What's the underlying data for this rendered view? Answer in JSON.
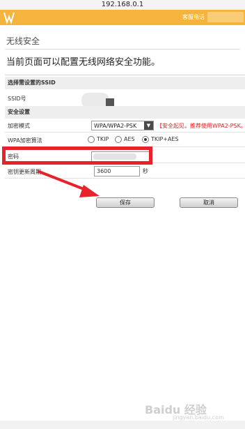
{
  "browser": {
    "address": "192.168.0.1"
  },
  "header": {
    "service_label": "客服电话"
  },
  "page": {
    "title": "无线安全",
    "description": "当前页面可以配置无线网络安全功能。"
  },
  "ssid_section": {
    "heading": "选择需设置的SSID",
    "ssid_label": "SSID号"
  },
  "security_section": {
    "heading": "安全设置",
    "encryption_label": "加密模式",
    "encryption_value": "WPA/WPA2-PSK",
    "encryption_note": "【安全起见，推荐使用WPA2-PSK。",
    "algorithm_label": "WPA加密算法",
    "algorithm_options": [
      "TKIP",
      "AES",
      "TKIP+AES"
    ],
    "algorithm_selected": "TKIP+AES",
    "password_label": "密码",
    "rekey_label": "密钥更新周期",
    "rekey_value": "3600",
    "rekey_unit": "秒"
  },
  "actions": {
    "save_label": "保存",
    "cancel_label": "取消"
  },
  "watermark": {
    "text": "Baidu 经验",
    "sub": "jingyan.baidu.com"
  },
  "colors": {
    "accent": "#f4b43d",
    "annotation": "#e8212a",
    "warning_text": "#e02020"
  }
}
